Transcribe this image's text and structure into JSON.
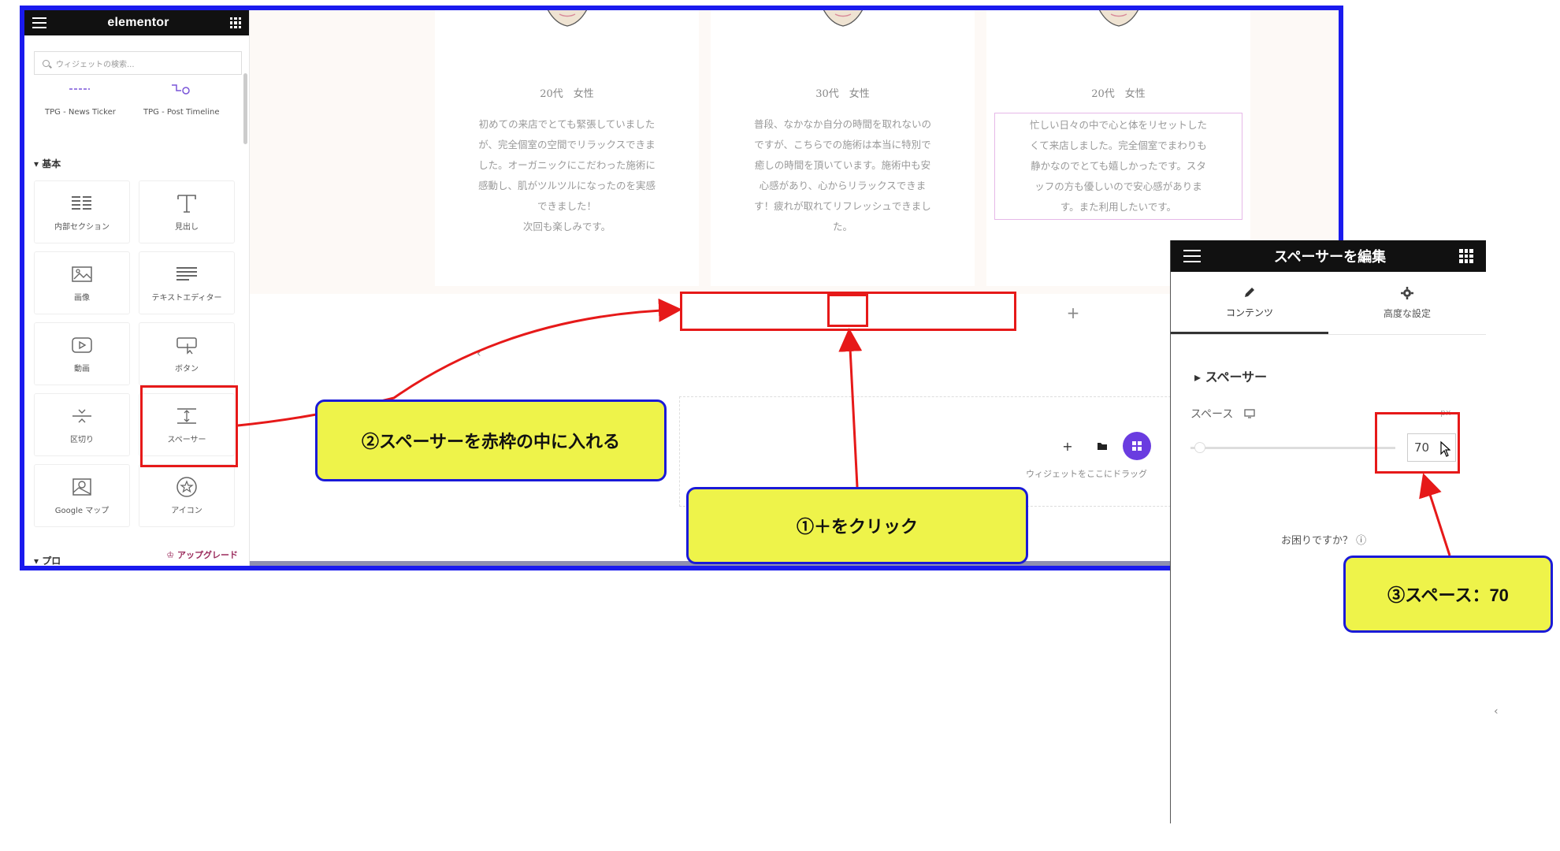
{
  "sidebar": {
    "brand": "elementor",
    "search_placeholder": "ウィジェットの検索...",
    "tpg_items": [
      "TPG - News Ticker",
      "TPG - Post Timeline"
    ],
    "section_basic": "基本",
    "widgets": [
      "内部セクション",
      "見出し",
      "画像",
      "テキストエディター",
      "動画",
      "ボタン",
      "区切り",
      "スペーサー",
      "Google マップ",
      "アイコン"
    ],
    "section_pro": "プロ",
    "upgrade": "アップグレード"
  },
  "canvas": {
    "cards": [
      {
        "label": "20代　女性",
        "lines": [
          "初めての来店でとても緊張していました",
          "が、完全個室の空間でリラックスできま",
          "した。オーガニックにこだわった施術に",
          "感動し、肌がツルツルになったのを実感",
          "できました！",
          "次回も楽しみです。"
        ]
      },
      {
        "label": "30代　女性",
        "lines": [
          "普段、なかなか自分の時間を取れないの",
          "ですが、こちらでの施術は本当に特別で",
          "癒しの時間を頂いています。施術中も安",
          "心感があり、心からリラックスできま",
          "す！疲れが取れてリフレッシュできまし",
          "た。"
        ]
      },
      {
        "label": "20代　女性",
        "lines": [
          "忙しい日々の中で心と体をリセットした",
          "くて来店しました。完全個室でまわりも",
          "静かなのでとても嬉しかったです。スタ",
          "ッフの方も優しいので安心感がありま",
          "す。また利用したいです。"
        ]
      }
    ],
    "add_symbol": "+",
    "drop_text": "ウィジェットをここにドラッグ"
  },
  "panel": {
    "title": "スペーサーを編集",
    "tab_content": "コンテンツ",
    "tab_advanced": "高度な設定",
    "section": "スペーサー",
    "space_label": "スペース",
    "unit": "px",
    "space_value": "70",
    "help": "お困りですか？"
  },
  "annotations": {
    "step1": "①＋をクリック",
    "step2": "②スペーサーを赤枠の中に入れる",
    "step3": "③スペース：70"
  },
  "colors": {
    "frame": "#1a1aee",
    "annotation_red": "#e61919",
    "callout_yellow": "#eef34a",
    "accent_purple": "#6a3ce0"
  }
}
